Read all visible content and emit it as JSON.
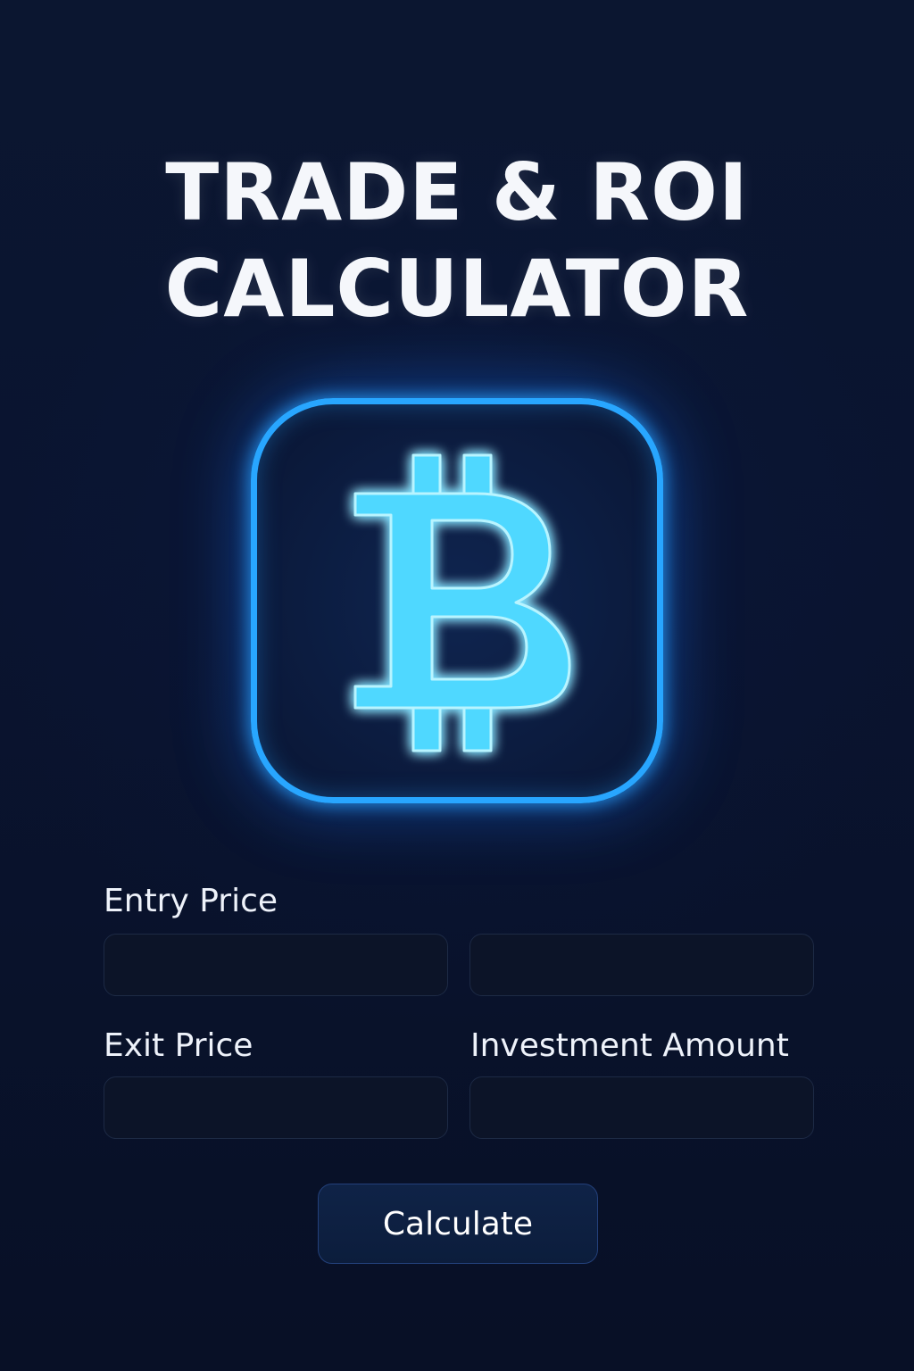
{
  "header": {
    "title_line1": "TRADE & ROI",
    "title_line2": "CALCULATOR"
  },
  "logo": {
    "icon": "bitcoin-icon",
    "glow_color": "#28a6ff",
    "symbol_color": "#5fe3ff"
  },
  "form": {
    "entry_price_label": "Entry Price",
    "entry_price_value": "",
    "secondary_value": "",
    "exit_price_label": "Exit Price",
    "exit_price_value": "",
    "investment_label": "Investment Amount",
    "investment_value": ""
  },
  "actions": {
    "calculate_label": "Calculate"
  },
  "colors": {
    "background": "#0a1430",
    "field_background": "#0c1428",
    "button_background": "#0f2347"
  }
}
